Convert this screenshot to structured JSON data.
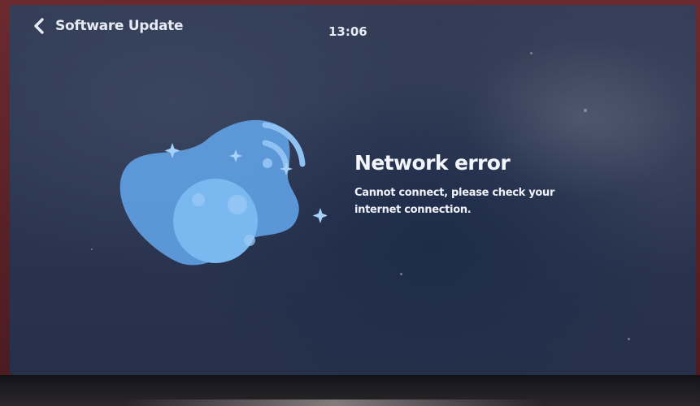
{
  "header": {
    "back_label": "Software Update",
    "time": "13:06"
  },
  "icons": {
    "back": "chevron-left-icon",
    "illustration": "network-error-illustration"
  },
  "message": {
    "title": "Network error",
    "description": "Cannot connect, please check your internet connection."
  },
  "colors": {
    "screen_background": "#2b3550",
    "illustration_blob": "#5f9fe2",
    "illustration_globe": "#7ab8f0",
    "text": "#f2f5fa"
  }
}
